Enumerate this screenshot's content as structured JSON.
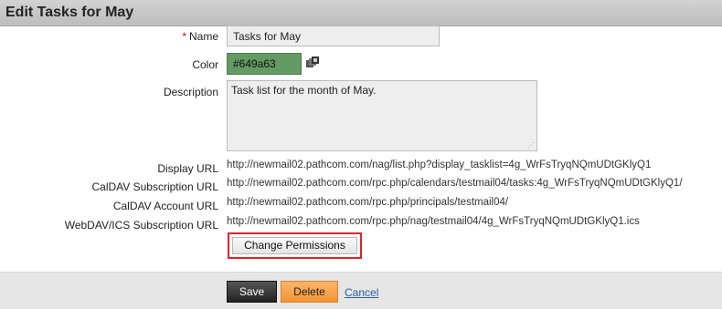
{
  "header": {
    "title": "Edit Tasks for May"
  },
  "form": {
    "name_required_mark": "*",
    "name_label": "Name",
    "name_value": "Tasks for May",
    "color_label": "Color",
    "color_value": "#649a63",
    "color_swatch": "#649a63",
    "color_picker_icon": "color-palette-icon",
    "description_label": "Description",
    "description_value": "Task list for the month of May.",
    "display_url_label": "Display URL",
    "display_url_value": "http://newmail02.pathcom.com/nag/list.php?display_tasklist=4g_WrFsTryqNQmUDtGKlyQ1",
    "caldav_sub_label": "CalDAV Subscription URL",
    "caldav_sub_value": "http://newmail02.pathcom.com/rpc.php/calendars/testmail04/tasks:4g_WrFsTryqNQmUDtGKlyQ1/",
    "caldav_account_label": "CalDAV Account URL",
    "caldav_account_value": "http://newmail02.pathcom.com/rpc.php/principals/testmail04/",
    "webdav_label": "WebDAV/ICS Subscription URL",
    "webdav_value": "http://newmail02.pathcom.com/rpc.php/nag/testmail04/4g_WrFsTryqNQmUDtGKlyQ1.ics",
    "change_permissions_label": "Change Permissions"
  },
  "footer": {
    "save_label": "Save",
    "delete_label": "Delete",
    "cancel_label": "Cancel"
  }
}
